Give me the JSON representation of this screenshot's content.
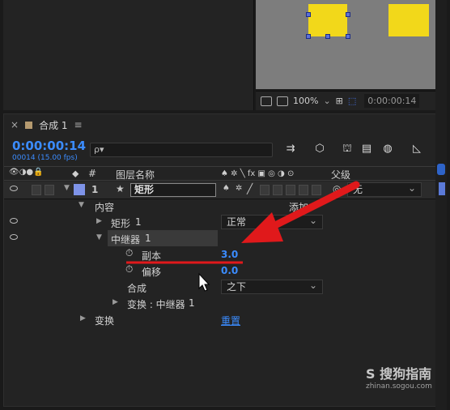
{
  "viewer": {
    "zoom": "100%",
    "timecode": "0:00:00:14"
  },
  "timeline": {
    "tab_close": "×",
    "tab_title": "合成 1",
    "tab_menu": "≡",
    "timecode": "0:00:00:14",
    "frame_info": "00014 (15.00 fps)",
    "search_placeholder": "ρ▾"
  },
  "columns": {
    "hash": "#",
    "layer_name": "图层名称",
    "switches": "♠ ✲ ╲ fx ▣ ◎ ◑ ⊙",
    "parent": "父级"
  },
  "layer": {
    "number": "1",
    "star": "★",
    "name": "矩形",
    "parent_value": "无"
  },
  "properties": {
    "contents": "内容",
    "add_label": "添加:",
    "rect": "矩形",
    "rect_num": "1",
    "rect_mode": "正常",
    "repeater": "中继器",
    "repeater_num": "1",
    "copies": "副本",
    "copies_value": "3.0",
    "offset": "偏移",
    "offset_value": "0.0",
    "composite": "合成",
    "composite_value": "之下",
    "transform_repeater": "变换 : 中继器",
    "transform_repeater_num": "1",
    "transform": "变换",
    "reset": "重置"
  },
  "watermark": {
    "logo": "S 搜狗指南",
    "url": "zhinan.sogou.com"
  },
  "colors": {
    "accent_blue": "#3b8cff",
    "annotation_red": "#e0191b",
    "shape_yellow": "#f2d81a",
    "layer_label": "#7e93e8"
  }
}
